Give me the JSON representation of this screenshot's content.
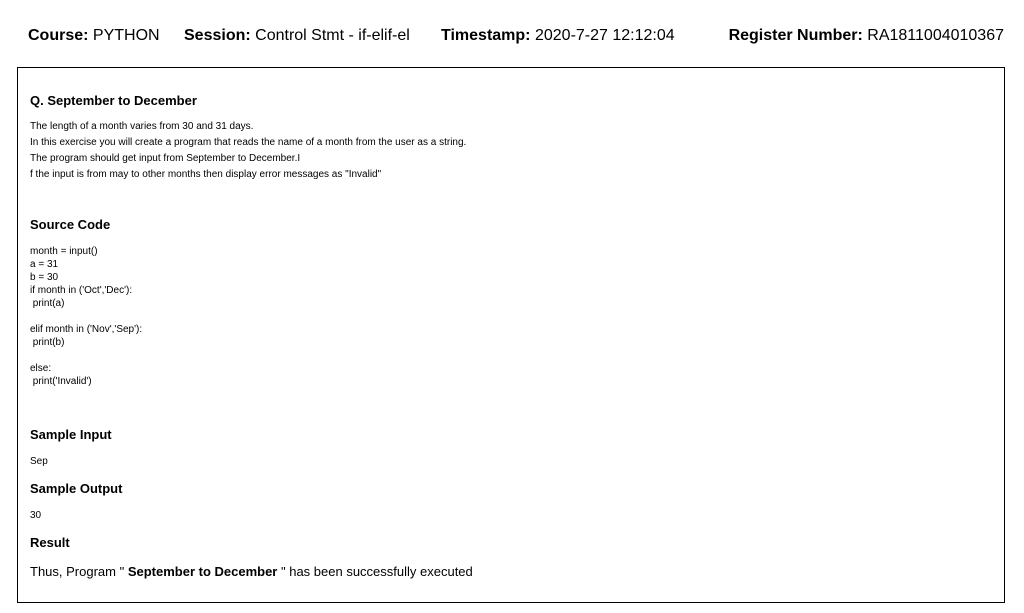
{
  "header": {
    "course_label": "Course:",
    "course_value": "PYTHON",
    "session_label": "Session:",
    "session_value": "Control Stmt - if-elif-el",
    "timestamp_label": "Timestamp:",
    "timestamp_value": "2020-7-27 12:12:04",
    "register_label": "Register Number:",
    "register_value": "RA1811004010367"
  },
  "question": {
    "title": "Q. September to December",
    "lines": [
      "The length of a month varies from 30 and 31 days.",
      "In this exercise you will create a program that reads the name of a month from the user as a string.",
      "The program should get input from September to December.I",
      "f the input is from may to other months then display error messages as \"Invalid\""
    ]
  },
  "source": {
    "title": "Source Code",
    "code": "month = input()\na = 31\nb = 30\nif month in ('Oct','Dec'):\n print(a)\n\nelif month in ('Nov','Sep'):\n print(b)\n\nelse:\n print('Invalid')"
  },
  "sample_input": {
    "title": "Sample Input",
    "value": "Sep"
  },
  "sample_output": {
    "title": "Sample Output",
    "value": "30"
  },
  "result": {
    "title": "Result",
    "prefix": "Thus, Program \" ",
    "program_name": "September to December",
    "suffix": " \" has been successfully executed"
  }
}
